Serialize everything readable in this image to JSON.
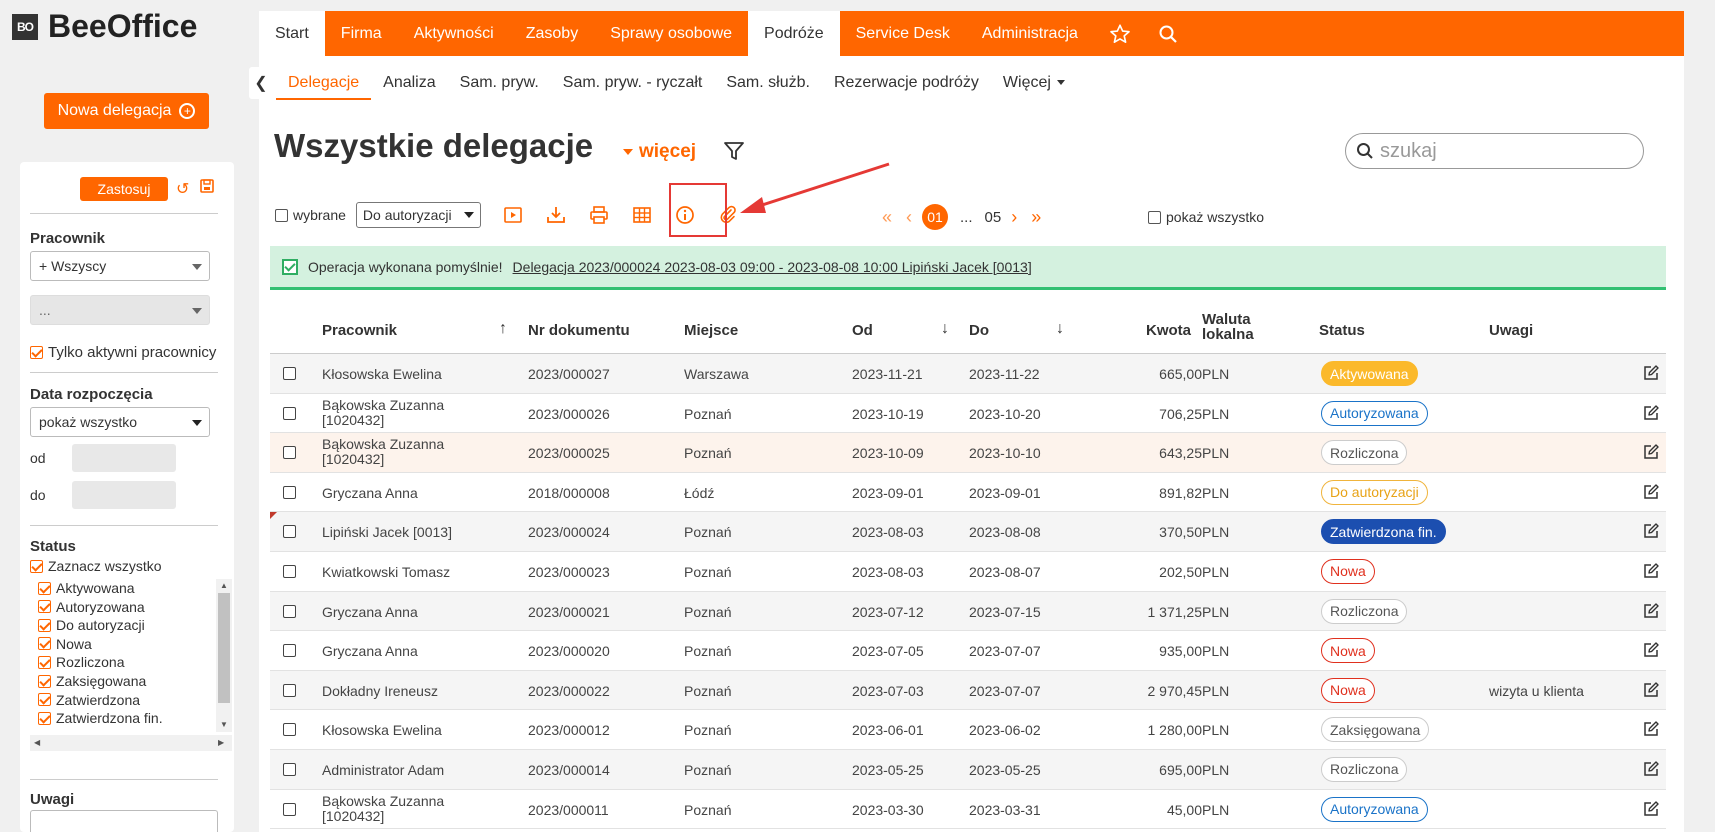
{
  "app": {
    "logo_text": "BO",
    "name": "BeeOffice"
  },
  "sidebar": {
    "new_button": "Nowa delegacja",
    "apply": "Zastosuj",
    "employee_label": "Pracownik",
    "employee_value": "+ Wszyscy",
    "secondary_value": "...",
    "only_active": "Tylko aktywni pracownicy",
    "start_date_label": "Data rozpoczęcia",
    "start_date_value": "pokaż wszystko",
    "from_label": "od",
    "to_label": "do",
    "status_label": "Status",
    "select_all": "Zaznacz wszystko",
    "statuses": [
      "Aktywowana",
      "Autoryzowana",
      "Do autoryzacji",
      "Nowa",
      "Rozliczona",
      "Zaksięgowana",
      "Zatwierdzona",
      "Zatwierdzona fin."
    ],
    "notes_label": "Uwagi"
  },
  "topnav": [
    "Start",
    "Firma",
    "Aktywności",
    "Zasoby",
    "Sprawy osobowe",
    "Podróże",
    "Service Desk",
    "Administracja"
  ],
  "subnav": [
    "Delegacje",
    "Analiza",
    "Sam. pryw.",
    "Sam. pryw. - ryczałt",
    "Sam. służb.",
    "Rezerwacje podróży",
    "Więcej"
  ],
  "page": {
    "title": "Wszystkie delegacje",
    "more": "więcej",
    "search_placeholder": "szukaj"
  },
  "toolbar": {
    "selected": "wybrane",
    "action": "Do autoryzacji",
    "show_all": "pokaż wszystko"
  },
  "pager": {
    "current": "01",
    "ellipsis": "...",
    "last": "05"
  },
  "alert": {
    "message": "Operacja wykonana pomyślnie!",
    "link": "Delegacja 2023/000024 2023-08-03 09:00 - 2023-08-08 10:00 Lipiński Jacek [0013]"
  },
  "table": {
    "headers": {
      "employee": "Pracownik",
      "doc": "Nr dokumentu",
      "place": "Miejsce",
      "from": "Od",
      "to": "Do",
      "amount": "Kwota",
      "currency1": "Waluta",
      "currency2": "lokalna",
      "status": "Status",
      "notes": "Uwagi"
    },
    "rows": [
      {
        "employee": "Kłosowska Ewelina",
        "doc": "2023/000027",
        "place": "Warszawa",
        "from": "2023-11-21",
        "to": "2023-11-22",
        "amount": "665,00",
        "currency": "PLN",
        "status": "Aktywowana",
        "notes": ""
      },
      {
        "employee": "Bąkowska Zuzanna [1020432]",
        "doc": "2023/000026",
        "place": "Poznań",
        "from": "2023-10-19",
        "to": "2023-10-20",
        "amount": "706,25",
        "currency": "PLN",
        "status": "Autoryzowana",
        "notes": ""
      },
      {
        "employee": "Bąkowska Zuzanna [1020432]",
        "doc": "2023/000025",
        "place": "Poznań",
        "from": "2023-10-09",
        "to": "2023-10-10",
        "amount": "643,25",
        "currency": "PLN",
        "status": "Rozliczona",
        "notes": ""
      },
      {
        "employee": "Gryczana Anna",
        "doc": "2018/000008",
        "place": "Łódź",
        "from": "2023-09-01",
        "to": "2023-09-01",
        "amount": "891,82",
        "currency": "PLN",
        "status": "Do autoryzacji",
        "notes": ""
      },
      {
        "employee": "Lipiński Jacek [0013]",
        "doc": "2023/000024",
        "place": "Poznań",
        "from": "2023-08-03",
        "to": "2023-08-08",
        "amount": "370,50",
        "currency": "PLN",
        "status": "Zatwierdzona fin.",
        "notes": ""
      },
      {
        "employee": "Kwiatkowski Tomasz",
        "doc": "2023/000023",
        "place": "Poznań",
        "from": "2023-08-03",
        "to": "2023-08-07",
        "amount": "202,50",
        "currency": "PLN",
        "status": "Nowa",
        "notes": ""
      },
      {
        "employee": "Gryczana Anna",
        "doc": "2023/000021",
        "place": "Poznań",
        "from": "2023-07-12",
        "to": "2023-07-15",
        "amount": "1 371,25",
        "currency": "PLN",
        "status": "Rozliczona",
        "notes": ""
      },
      {
        "employee": "Gryczana Anna",
        "doc": "2023/000020",
        "place": "Poznań",
        "from": "2023-07-05",
        "to": "2023-07-07",
        "amount": "935,00",
        "currency": "PLN",
        "status": "Nowa",
        "notes": ""
      },
      {
        "employee": "Dokładny Ireneusz",
        "doc": "2023/000022",
        "place": "Poznań",
        "from": "2023-07-03",
        "to": "2023-07-07",
        "amount": "2 970,45",
        "currency": "PLN",
        "status": "Nowa",
        "notes": "wizyta u klienta"
      },
      {
        "employee": "Kłosowska Ewelina",
        "doc": "2023/000012",
        "place": "Poznań",
        "from": "2023-06-01",
        "to": "2023-06-02",
        "amount": "1 280,00",
        "currency": "PLN",
        "status": "Zaksięgowana",
        "notes": ""
      },
      {
        "employee": "Administrator Adam",
        "doc": "2023/000014",
        "place": "Poznań",
        "from": "2023-05-25",
        "to": "2023-05-25",
        "amount": "695,00",
        "currency": "PLN",
        "status": "Rozliczona",
        "notes": ""
      },
      {
        "employee": "Bąkowska Zuzanna [1020432]",
        "doc": "2023/000011",
        "place": "Poznań",
        "from": "2023-03-30",
        "to": "2023-03-31",
        "amount": "45,00",
        "currency": "PLN",
        "status": "Autoryzowana",
        "notes": ""
      }
    ]
  },
  "colors": {
    "accent": "#ff6600",
    "status": {
      "Aktywowana": {
        "bg": "#fbb92b",
        "fg": "#ffffff",
        "border": "#fbb92b"
      },
      "Autoryzowana": {
        "bg": "#ffffff",
        "fg": "#1a73c8",
        "border": "#1a73c8"
      },
      "Rozliczona": {
        "bg": "#ffffff",
        "fg": "#555555",
        "border": "#cccccc"
      },
      "Do autoryzacji": {
        "bg": "#ffffff",
        "fg": "#e8a317",
        "border": "#f0b43c"
      },
      "Zatwierdzona fin.": {
        "bg": "#1c4fb0",
        "fg": "#ffffff",
        "border": "#1c4fb0"
      },
      "Nowa": {
        "bg": "#ffffff",
        "fg": "#e0301e",
        "border": "#e0301e"
      },
      "Zaksięgowana": {
        "bg": "#ffffff",
        "fg": "#555555",
        "border": "#cccccc"
      }
    }
  }
}
